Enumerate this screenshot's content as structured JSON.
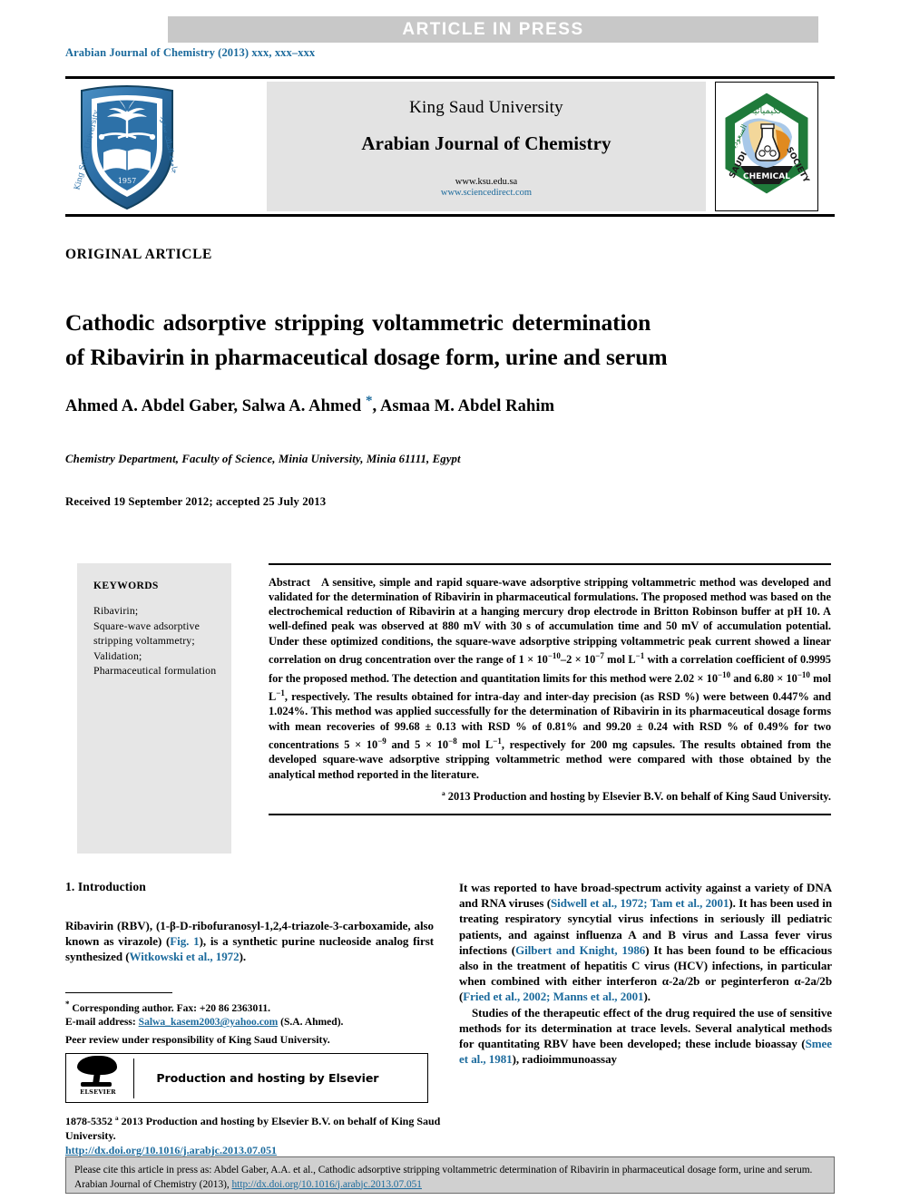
{
  "banner": {
    "text": "ARTICLE  IN  PRESS"
  },
  "journal_ref": {
    "text": "Arabian Journal of Chemistry (2013) xxx, xxx–xxx"
  },
  "masthead": {
    "university": "King Saud University",
    "journal_title": "Arabian Journal of Chemistry",
    "url_ksu": "www.ksu.edu.sa",
    "url_sciencedirect": "www.sciencedirect.com",
    "left_logo_name": "king-saud-university-seal",
    "right_logo_name": "saudi-chemical-society-seal",
    "right_logo_text_top": "الكيميائية",
    "right_logo_text_left": "السعودية",
    "right_logo_text_arc_left": "SAUDI",
    "right_logo_text_arc_right": "SOCIETY",
    "right_logo_text_bottom": "CHEMICAL"
  },
  "article_type": "ORIGINAL ARTICLE",
  "title": {
    "line1": "Cathodic adsorptive stripping voltammetric determination",
    "line2": "of Ribavirin in pharmaceutical dosage form, urine and serum"
  },
  "authors": {
    "part1": "Ahmed A. Abdel Gaber, Salwa A. Ahmed ",
    "star": "*",
    "part2": ", Asmaa M. Abdel Rahim"
  },
  "affiliation": "Chemistry Department, Faculty of Science, Minia University, Minia 61111, Egypt",
  "dates": "Received 19 September 2012; accepted 25 July 2013",
  "keywords": {
    "heading": "KEYWORDS",
    "items": [
      "Ribavirin;",
      "Square-wave adsorptive",
      "stripping voltammetry;",
      "Validation;",
      "Pharmaceutical formulation"
    ]
  },
  "abstract": {
    "label": "Abstract",
    "text_part1": "A sensitive, simple and rapid square-wave adsorptive stripping voltammetric method was developed and validated for the determination of Ribavirin in pharmaceutical formulations. The proposed method was based on the electrochemical reduction of Ribavirin at a hanging mercury drop electrode in Britton Robinson buffer at pH 10. A well-defined peak was observed at 880 mV with 30 s of accumulation time and 50 mV of accumulation potential. Under these optimized conditions, the square-wave adsorptive stripping voltammetric peak current showed a linear correlation on drug concentration over the range of 1 × 10",
    "exp1": "−10",
    "text_part2": "–2 × 10",
    "exp2": "−7",
    "text_part3": " mol L",
    "exp3": "−1",
    "text_part4": " with a correlation coefficient of 0.9995 for the proposed method. The detection and quantitation limits for this method were 2.02 × 10",
    "exp4": "−10",
    "text_part5": " and 6.80 × 10",
    "exp5": "−10",
    "text_part6": " mol L",
    "exp6": "−1",
    "text_part7": ", respectively. The results obtained for intra-day and inter-day precision (as RSD %) were between 0.447% and 1.024%. This method was applied successfully for the determination of Ribavirin in its pharmaceutical dosage forms with mean recoveries of 99.68 ± 0.13 with RSD % of 0.81% and 99.20 ± 0.24 with RSD % of 0.49% for two concentrations 5 × 10",
    "exp7": "−9",
    "text_part8": " and 5 × 10",
    "exp8": "−8",
    "text_part9": " mol L",
    "exp9": "−1",
    "text_part10": ", respectively for 200 mg capsules. The results obtained from the developed square-wave adsorptive stripping voltammetric method were compared with those obtained by the analytical method reported in the literature.",
    "copyright": "ª 2013 Production and hosting by Elsevier B.V. on behalf of King Saud University."
  },
  "introduction": {
    "heading": "1. Introduction",
    "para1_a": "Ribavirin (RBV), (1-β-",
    "para1_smallcaps": "D",
    "para1_b": "-ribofuranosyl-1,2,4-triazole-3-carboxamide, also known as virazole) (",
    "para1_ref1": "Fig. 1",
    "para1_c": "), is a synthetic purine nucleoside analog first synthesized (",
    "para1_ref2": "Witkowski et al., 1972",
    "para1_d": ")."
  },
  "right_column": {
    "para1_a": "It was reported to have broad-spectrum activity against a variety of DNA and RNA viruses (",
    "para1_ref1": "Sidwell et al., 1972; Tam et al., 2001",
    "para1_b": "). It has been used in treating respiratory syncytial virus infections in seriously ill pediatric patients, and against influenza A and B virus and Lassa fever virus infections (",
    "para1_ref2": "Gilbert and Knight, 1986",
    "para1_c": ") It has been found to be efficacious also in the treatment of hepatitis C virus (HCV) infections, in particular when combined with either interferon α-2a/2b or peginterferon α-2a/2b (",
    "para1_ref3": "Fried et al., 2002; Manns et al., 2001",
    "para1_d": ").",
    "para2_a": "Studies of the therapeutic effect of the drug required the use of sensitive methods for its determination at trace levels. Several analytical methods for quantitating RBV have been developed; these include bioassay (",
    "para2_ref1": "Smee et al., 1981",
    "para2_b": "), radioimmunoassay"
  },
  "footnote": {
    "star": "*",
    "corresponding": " Corresponding author. Fax: +20 86 2363011.",
    "email_label": "E-mail address: ",
    "email": "Salwa_kasem2003@yahoo.com",
    "email_suffix": " (S.A. Ahmed).",
    "peer_review": "Peer review under responsibility of King Saud University."
  },
  "elsevier_box": {
    "text": "Production and hosting by Elsevier",
    "logo_word": "ELSEVIER"
  },
  "issn_block": {
    "line1": "1878-5352 ª 2013 Production and hosting by Elsevier B.V. on behalf of King Saud University.",
    "doi": "http://dx.doi.org/10.1016/j.arabjc.2013.07.051"
  },
  "citation_box": {
    "text_a": "Please cite this article in press as: Abdel Gaber, A.A. et al., Cathodic adsorptive stripping voltammetric determination of Ribavirin in pharmaceutical dosage form, urine and serum. Arabian Journal of Chemistry (2013), ",
    "doi": "http://dx.doi.org/10.1016/j.arabjc.2013.07.051"
  },
  "colors": {
    "link_blue": "#1b6a9c",
    "banner_gray": "#c8c8c8",
    "masthead_gray": "#e3e3e3",
    "keywords_gray": "#e6e6e6",
    "citation_gray": "#d0d0d0"
  }
}
